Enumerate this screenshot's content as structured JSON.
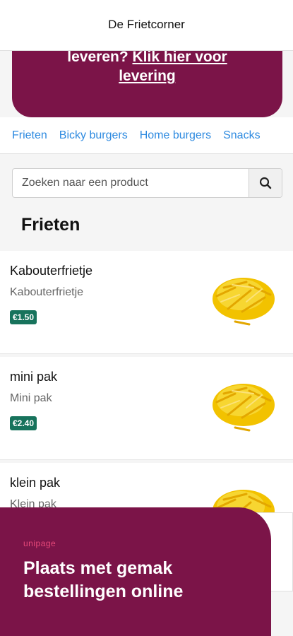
{
  "header": {
    "title": "De Frietcorner"
  },
  "banner": {
    "line1_text": "leveren? ",
    "line1_link": "Klik hier voor",
    "line2_link": "levering"
  },
  "categories": [
    "Frieten",
    "Bicky burgers",
    "Home burgers",
    "Snacks"
  ],
  "search": {
    "placeholder": "Zoeken naar een product",
    "icon": "search-icon"
  },
  "section": {
    "title": "Frieten"
  },
  "products": [
    {
      "name": "Kabouterfrietje",
      "description": "Kabouterfrietje",
      "price": "€1.50"
    },
    {
      "name": "mini pak",
      "description": "Mini pak",
      "price": "€2.40"
    },
    {
      "name": "klein pak",
      "description": "Klein pak",
      "price": ""
    }
  ],
  "promo": {
    "brand": "unipage",
    "headline_line1": "Plaats met gemak",
    "headline_line2": "bestellingen online"
  },
  "colors": {
    "brand": "#7b1448",
    "link": "#2d8ae0",
    "price": "#17735c",
    "promo_brand": "#e8497a"
  }
}
